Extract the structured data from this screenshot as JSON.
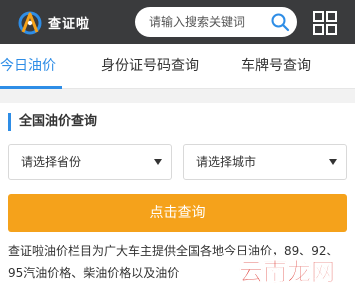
{
  "header": {
    "logo_text": "查证啦",
    "search_placeholder": "请输入搜索关键词",
    "colors": {
      "bar": "#3a3b3d",
      "accent": "#2e8de6",
      "logo_orange": "#f5a21b"
    }
  },
  "tabs": [
    {
      "label": "今日油价",
      "active": true
    },
    {
      "label": "身份证号码查询",
      "active": false
    },
    {
      "label": "车牌号查询",
      "active": false
    }
  ],
  "form": {
    "title": "全国油价查询",
    "province_select": "请选择省份",
    "city_select": "请选择城市",
    "submit_label": "点击查询",
    "button_color": "#f5a21b"
  },
  "description": "查证啦油价栏目为广大车主提供全国各地今日油价，89、92、95汽油价格、柴油价格以及油价",
  "watermark": {
    "text": "云南龙网",
    "color": "#d9231c"
  },
  "icons": [
    "logo-icon",
    "search-icon",
    "grid-menu-icon",
    "dropdown-caret-icon"
  ]
}
